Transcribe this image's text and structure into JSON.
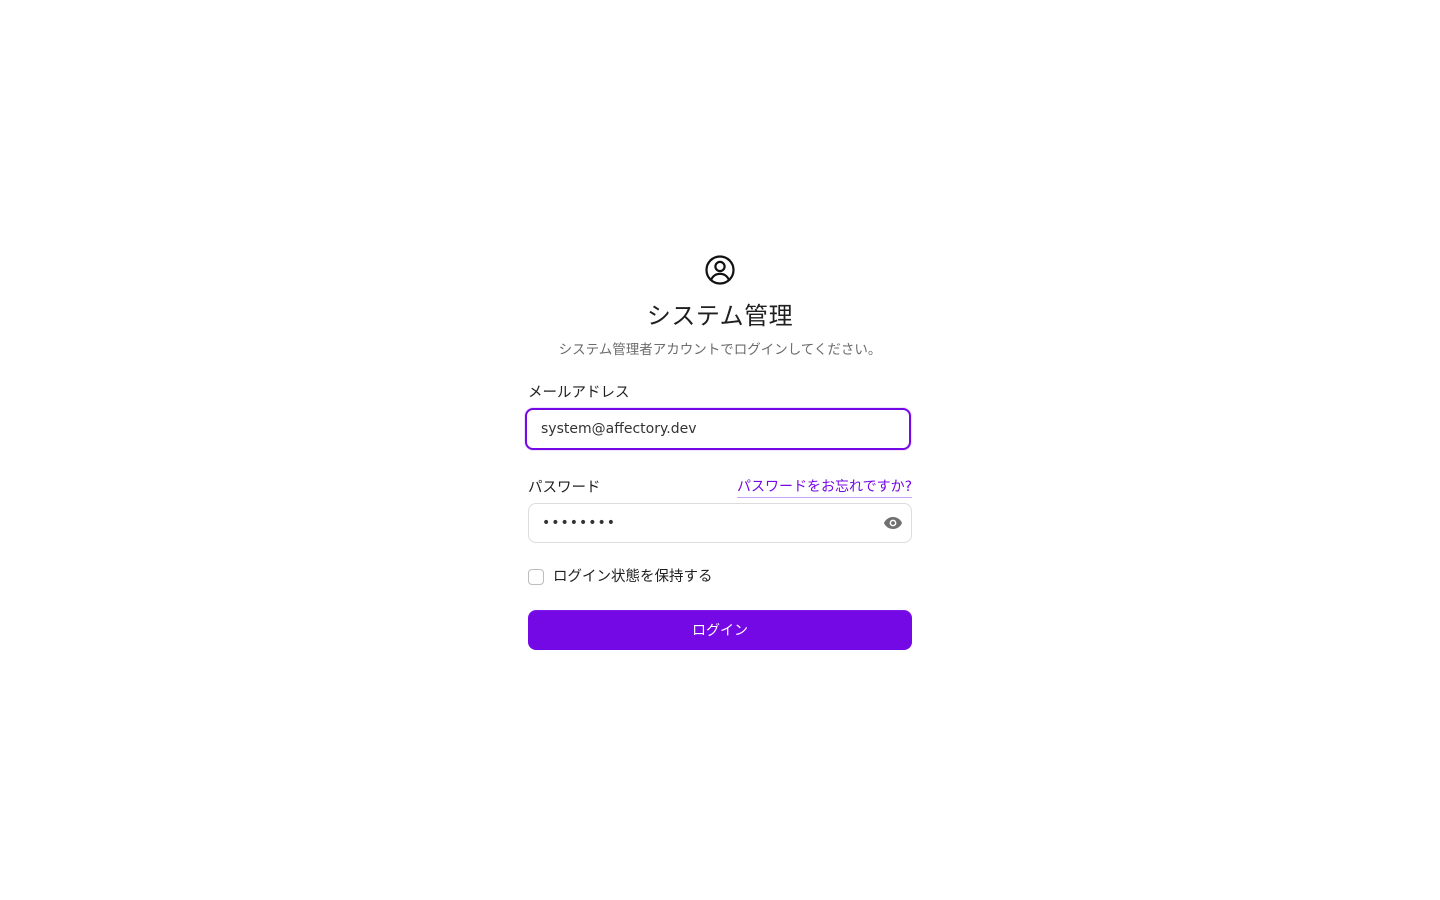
{
  "header": {
    "icon": "user-circle-icon",
    "title": "システム管理",
    "subtitle": "システム管理者アカウントでログインしてください。"
  },
  "form": {
    "email": {
      "label": "メールアドレス",
      "value": "system@affectory.dev"
    },
    "password": {
      "label": "パスワード",
      "masked_value": "••••••••",
      "forgot_link": "パスワードをお忘れですか?",
      "toggle_icon": "eye-icon"
    },
    "remember": {
      "label": "ログイン状態を保持する",
      "checked": false
    },
    "submit_label": "ログイン"
  },
  "colors": {
    "accent": "#7509e6",
    "text": "#1f1f1f",
    "muted": "#6b6b6b",
    "border": "#dcdcdc"
  }
}
